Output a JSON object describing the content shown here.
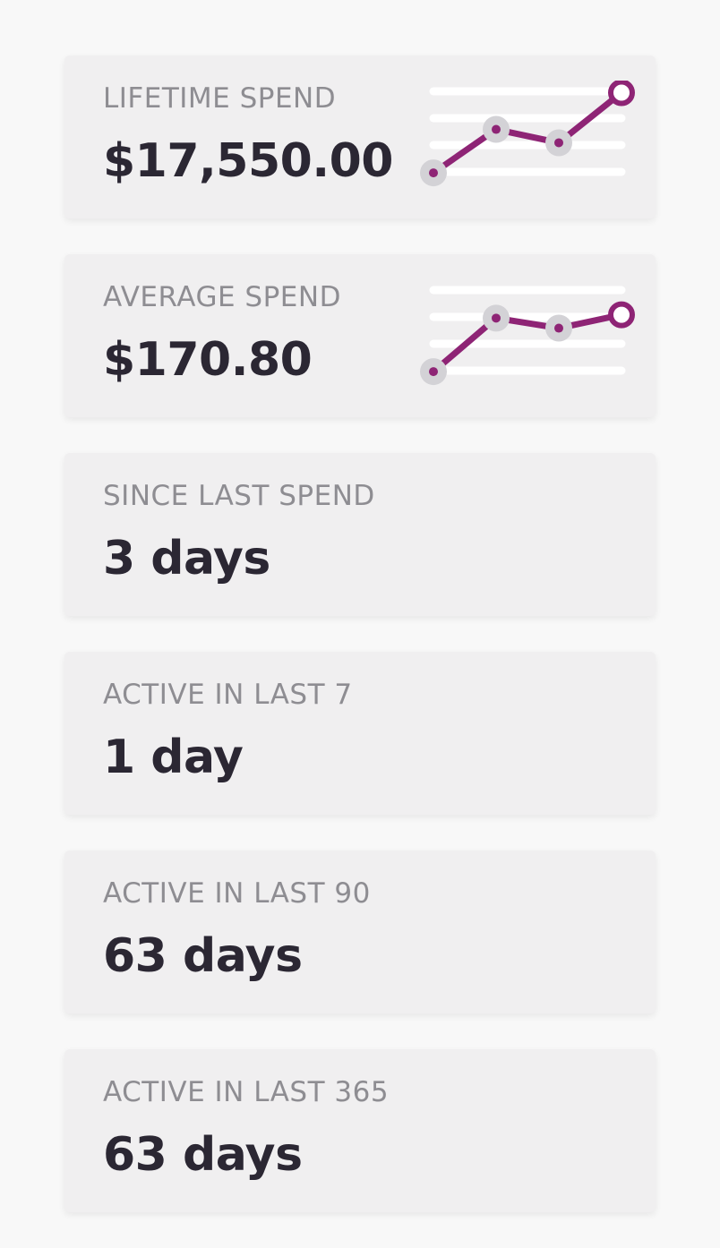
{
  "colors": {
    "accent": "#8e2475",
    "dot_halo": "#d3d2d6",
    "gridline": "#ffffff"
  },
  "cards": [
    {
      "label": "LIFETIME SPEND",
      "value": "$17,550.00",
      "trend": [
        1,
        2.3,
        1.9,
        3.4
      ]
    },
    {
      "label": "AVERAGE SPEND",
      "value": "$170.80",
      "trend": [
        1,
        2.6,
        2.3,
        2.7
      ]
    },
    {
      "label": "SINCE LAST SPEND",
      "value": "3 days"
    },
    {
      "label": "ACTIVE IN LAST 7",
      "value": "1 day"
    },
    {
      "label": "ACTIVE IN LAST 90",
      "value": "63 days"
    },
    {
      "label": "ACTIVE IN LAST 365",
      "value": "63 days"
    }
  ]
}
